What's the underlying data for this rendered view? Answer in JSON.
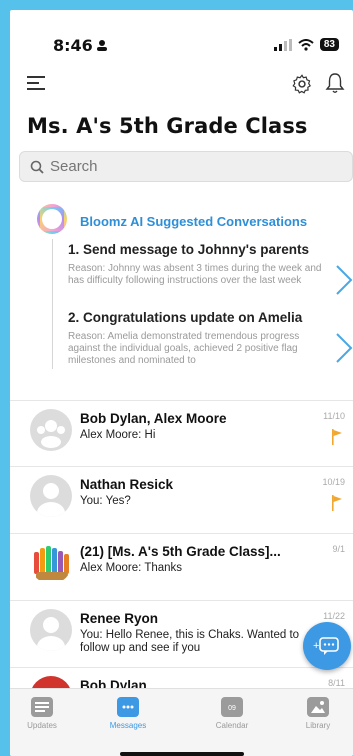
{
  "status": {
    "time": "8:46",
    "battery": "83"
  },
  "header": {
    "title": "Ms. A's 5th Grade Class"
  },
  "search": {
    "placeholder": "Search"
  },
  "ai": {
    "title": "Bloomz AI Suggested Conversations",
    "suggestions": [
      {
        "heading": "1. Send message to Johnny's parents",
        "reason": "Reason: Johnny was absent 3 times during the week and has difficulty following instructions over the last week"
      },
      {
        "heading": "2. Congratulations update on Amelia",
        "reason": "Reason: Amelia demonstrated tremendous progress against the individual goals, achieved 2 positive flag milestones and nominated to"
      }
    ]
  },
  "threads": [
    {
      "name": "Bob Dylan, Alex Moore",
      "message": "Alex Moore: Hi",
      "date": "11/10",
      "flagged": true
    },
    {
      "name": "Nathan Resick",
      "message": "You: Yes?",
      "date": "10/19",
      "flagged": true
    },
    {
      "name": "(21) [Ms. A's 5th Grade Class]...",
      "message": "Alex Moore: Thanks",
      "date": "9/1",
      "flagged": false
    },
    {
      "name": "Renee Ryon",
      "message": "You: Hello Renee, this is Chaks. Wanted to follow up and see if you",
      "date": "11/22",
      "flagged": false
    },
    {
      "name": "Bob Dylan",
      "message": "",
      "date": "8/11",
      "flagged": false
    }
  ],
  "tabs": [
    {
      "label": "Updates",
      "icon": "updates-icon"
    },
    {
      "label": "Messages",
      "icon": "messages-icon"
    },
    {
      "label": "Calendar",
      "icon": "calendar-icon",
      "badge": "09"
    },
    {
      "label": "Library",
      "icon": "library-icon"
    }
  ],
  "colors": {
    "accent": "#2e8fd6",
    "fab": "#3d99e4",
    "flag": "#f0a830",
    "frame": "#56c2ec"
  }
}
